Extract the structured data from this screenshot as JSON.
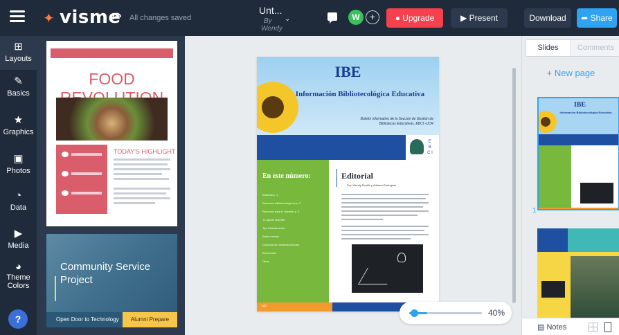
{
  "app": {
    "logo": "visme",
    "saved_status": "All changes saved"
  },
  "document": {
    "title": "Unt...",
    "by": "By",
    "author": "Wendy"
  },
  "header": {
    "avatar_initial": "W",
    "add_user": "+",
    "upgrade": "Upgrade",
    "present": "Present",
    "download": "Download",
    "share": "Share"
  },
  "left_nav": [
    {
      "label": "Layouts",
      "icon": "layouts-icon"
    },
    {
      "label": "Basics",
      "icon": "basics-icon"
    },
    {
      "label": "Graphics",
      "icon": "graphics-icon"
    },
    {
      "label": "Photos",
      "icon": "photos-icon"
    },
    {
      "label": "Data",
      "icon": "data-icon"
    },
    {
      "label": "Media",
      "icon": "media-icon"
    },
    {
      "label": "Theme Colors",
      "icon": "palette-icon"
    }
  ],
  "help_label": "?",
  "templates": {
    "t1": {
      "title": "FOOD REVOLUTION",
      "highlight": "TODAY'S HIGHLIGHT"
    },
    "t2": {
      "title": "Community Service Project",
      "footer_left": "Open Door to Technology",
      "footer_right": "Alumni Prepare"
    }
  },
  "slide": {
    "logo": "IBE",
    "subtitle": "Información Bibliotecológica Educativa",
    "boletin": "Boletín informativo de la Sección de Gestión de Bibliotecas Educativas, EBCI -UCR",
    "badge": "E B C I",
    "sidebar_title": "En este número:",
    "sidebar_items": [
      "Editorial p. 1",
      "Recursos bibliotecológicos p. 2",
      "Recursos para el docente p. 3",
      "Tu aporte docente",
      "Tips bibliotecarios",
      "Salud mental",
      "Columna de nuestros lectores",
      "Efemérides",
      "Otros"
    ],
    "editorial_title": "Editorial",
    "editorial_by": "Por: Wendy Bonilla y Adriana Rodríguez",
    "page_number": "147"
  },
  "zoom": {
    "value": "40%",
    "level": 0.4
  },
  "slides_panel": {
    "tab_slides": "Slides",
    "tab_comments": "Comments",
    "new_page": "+ New page",
    "slide1_number": "1",
    "notes": "Notes"
  },
  "colors": {
    "accent": "#2fa3f2",
    "upgrade": "#f4414d",
    "topbar": "#1f2a3a",
    "green": "#78b83c",
    "blue": "#1f4fa0"
  }
}
